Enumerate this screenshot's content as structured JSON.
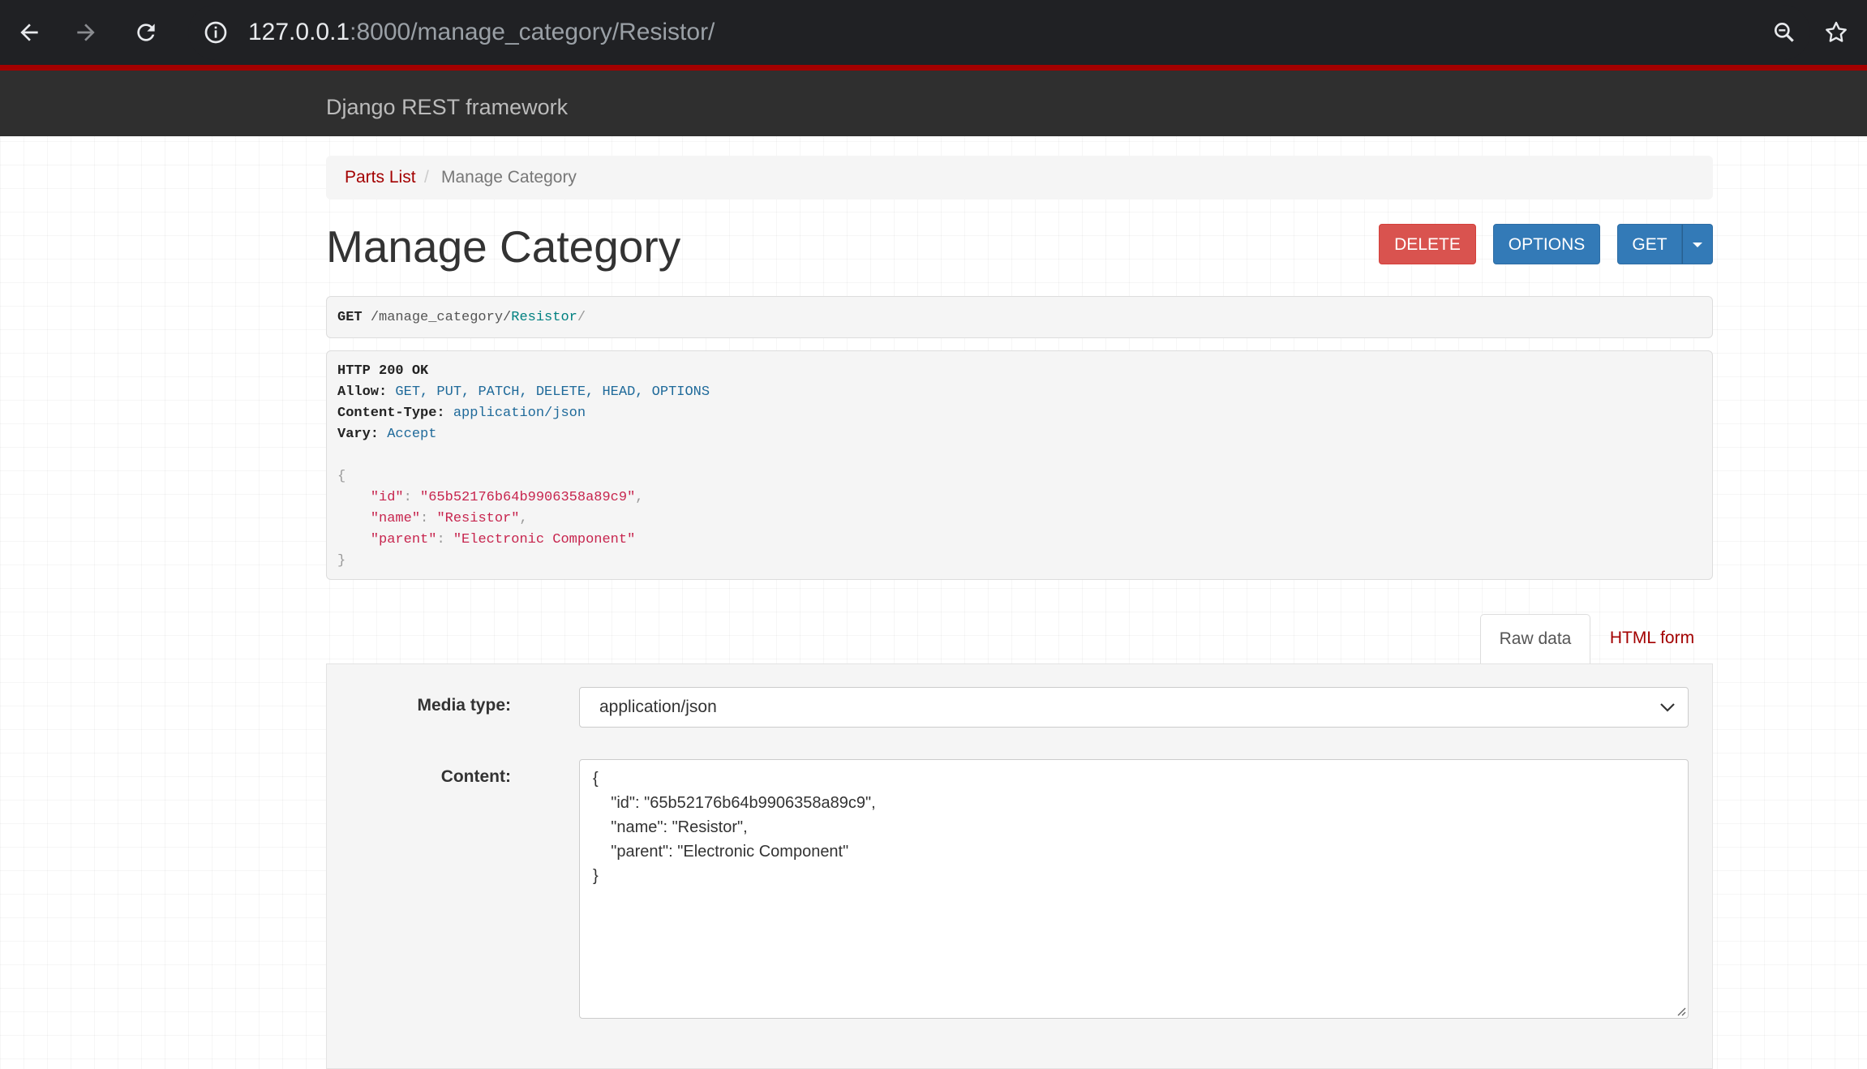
{
  "browser": {
    "url_host": "127.0.0.1",
    "url_path": ":8000/manage_category/Resistor/"
  },
  "navbar": {
    "brand": "Django REST framework"
  },
  "breadcrumb": {
    "parent": "Parts List",
    "separator": "/",
    "current": "Manage Category"
  },
  "page": {
    "title": "Manage Category"
  },
  "buttons": {
    "delete": "DELETE",
    "options": "OPTIONS",
    "get": "GET"
  },
  "request": {
    "method": "GET",
    "path_prefix": "/manage_category/",
    "path_param": "Resistor",
    "path_suffix": "/"
  },
  "response": {
    "status": "HTTP 200 OK",
    "allow_label": "Allow:",
    "allow_value": "GET, PUT, PATCH, DELETE, HEAD, OPTIONS",
    "content_type_label": "Content-Type:",
    "content_type_value": "application/json",
    "vary_label": "Vary:",
    "vary_value": "Accept",
    "open_brace": "{",
    "close_brace": "}",
    "fields": [
      {
        "key": "\"id\"",
        "value": "\"65b52176b64b9906358a89c9\"",
        "comma": ","
      },
      {
        "key": "\"name\"",
        "value": "\"Resistor\"",
        "comma": ","
      },
      {
        "key": "\"parent\"",
        "value": "\"Electronic Component\"",
        "comma": ""
      }
    ]
  },
  "tabs": {
    "raw": "Raw data",
    "html": "HTML form"
  },
  "form": {
    "media_type_label": "Media type:",
    "media_type_value": "application/json",
    "content_label": "Content:",
    "content_value": "{\n    \"id\": \"65b52176b64b9906358a89c9\",\n    \"name\": \"Resistor\",\n    \"parent\": \"Electronic Component\"\n}"
  }
}
